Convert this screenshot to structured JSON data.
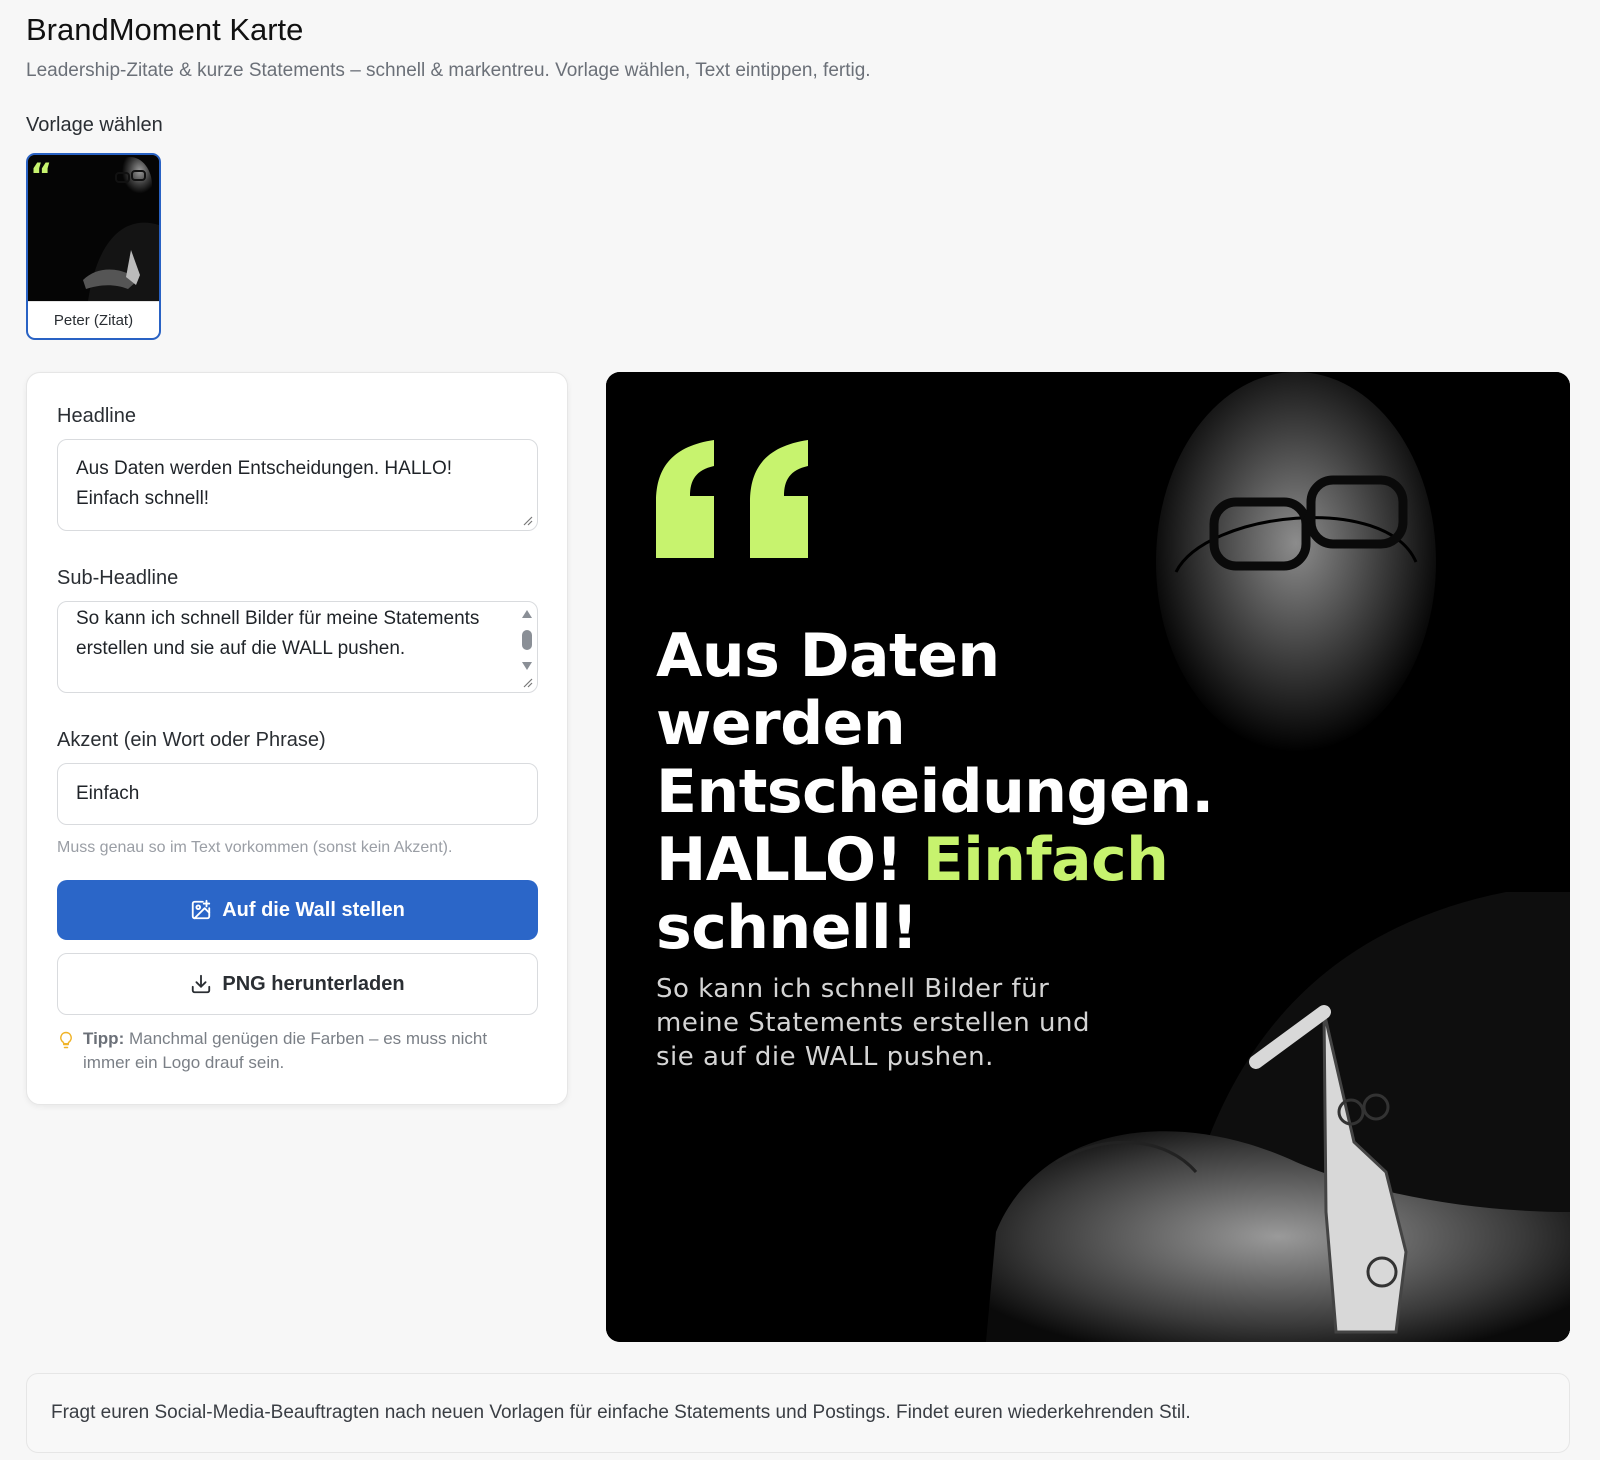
{
  "app": {
    "title": "BrandMoment Karte",
    "subtitle": "Leadership-Zitate & kurze Statements – schnell & markentreu. Vorlage wählen, Text eintippen, fertig."
  },
  "templates": {
    "section_label": "Vorlage wählen",
    "items": [
      {
        "name": "Peter (Zitat)",
        "selected": true
      }
    ]
  },
  "form": {
    "headline": {
      "label": "Headline",
      "value": "Aus Daten werden Entscheidungen. HALLO! Einfach schnell!"
    },
    "subheadline": {
      "label": "Sub-Headline",
      "value": "So kann ich schnell Bilder für meine Statements erstellen und sie auf die WALL pushen."
    },
    "accent": {
      "label": "Akzent (ein Wort oder Phrase)",
      "value": "Einfach",
      "hint": "Muss genau so im Text vorkommen (sonst kein Akzent)."
    },
    "primary_button": {
      "label": "Auf die Wall stellen",
      "icon": "image-plus-icon"
    },
    "secondary_button": {
      "label": "PNG herunterladen",
      "icon": "download-icon"
    },
    "tip": {
      "icon": "lightbulb-icon",
      "label": "Tipp:",
      "text": "Manchmal genügen die Farben – es muss nicht immer ein Logo drauf sein."
    }
  },
  "preview": {
    "headline_before": "Aus Daten werden Entscheidungen. HALLO!",
    "headline_accent": "Einfach",
    "headline_after": "schnell!",
    "subheadline": "So kann ich schnell Bilder für meine Statements erstellen und sie auf die WALL pushen.",
    "accent_color": "#c7f36e",
    "background_color": "#000000",
    "quote_icon": "quote-icon"
  },
  "footer": {
    "note": "Fragt euren Social-Media-Beauftragten nach neuen Vorlagen für einfache Statements und Postings. Findet euren wiederkehrenden Stil."
  },
  "colors": {
    "primary": "#2b66c8",
    "accent": "#c7f36e",
    "selected_border": "#2962c4"
  }
}
